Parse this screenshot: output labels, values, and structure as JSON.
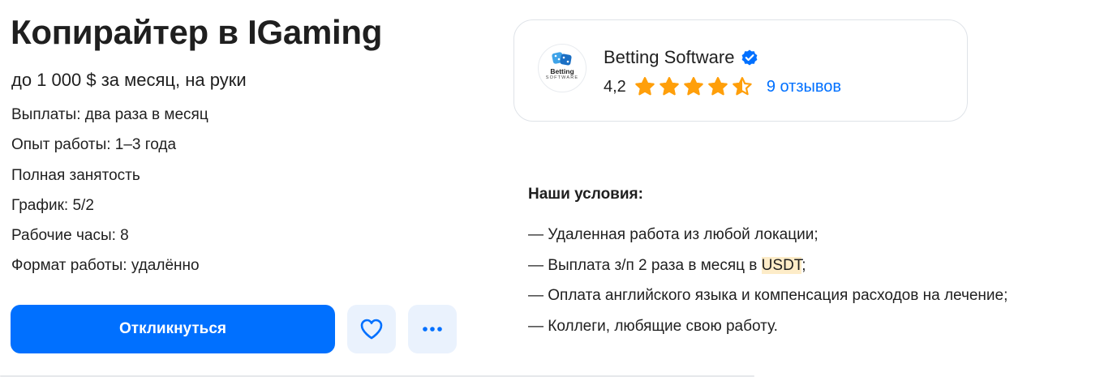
{
  "vacancy": {
    "title": "Копирайтер в IGaming",
    "salary": "до 1 000 $ за месяц, на руки",
    "details": [
      "Выплаты: два раза в месяц",
      "Опыт работы: 1–3 года",
      "Полная занятость",
      "График: 5/2",
      "Рабочие часы: 8",
      "Формат работы: удалённо"
    ]
  },
  "actions": {
    "apply_label": "Откликнуться",
    "favorite_icon": "heart-icon",
    "more_icon": "more-dots-icon"
  },
  "company": {
    "name": "Betting Software",
    "verified_icon": "verified-check-icon",
    "logo_text_main": "Betting",
    "logo_text_sub": "SOFTWARE",
    "rating": "4,2",
    "rating_stars": 4.2,
    "rating_max": 5,
    "reviews_label": "9 отзывов"
  },
  "conditions": {
    "title": "Наши условия:",
    "items": [
      {
        "prefix": "— Удаленная работа из любой локации;",
        "highlight": "",
        "suffix": ""
      },
      {
        "prefix": "— Выплата з/п 2 раза в месяц в ",
        "highlight": "USDT",
        "suffix": ";"
      },
      {
        "prefix": "— Оплата английского языка и компенсация расходов на лечение;",
        "highlight": "",
        "suffix": ""
      },
      {
        "prefix": "— Коллеги, любящие свою работу.",
        "highlight": "",
        "suffix": ""
      }
    ]
  },
  "colors": {
    "accent": "#0070ff",
    "icon_button_bg": "#eaf2fd",
    "star": "#ff9f0a",
    "highlight": "#fdecc8",
    "text": "#1f1f1f"
  }
}
